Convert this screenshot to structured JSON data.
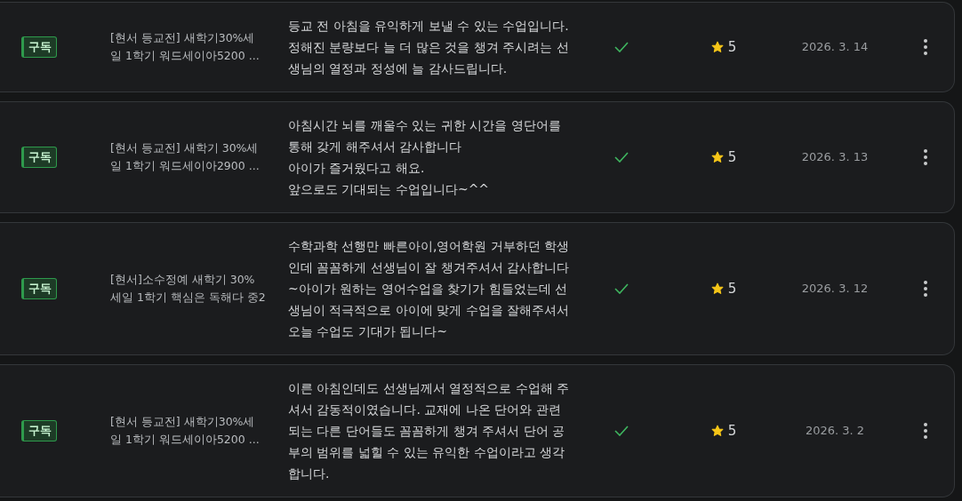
{
  "reviews": [
    {
      "badge": "구독",
      "title_lines": [
        "[현서 등교전] 새학기30%세",
        "일 1학기 워드세이아5200 ..."
      ],
      "review_lines": [
        "등교 전 아침을 유익하게 보낼 수 있는 수업입니다.",
        "정해진 분량보다 늘 더 많은 것을 챙겨 주시려는 선",
        "생님의 열정과 정성에 늘 감사드립니다."
      ],
      "checked": true,
      "rating": "5",
      "date": "2026. 3. 14"
    },
    {
      "badge": "구독",
      "title_lines": [
        "[현서 등교전] 새학기 30%세",
        "일 1학기 워드세이아2900 ..."
      ],
      "review_lines": [
        "아침시간 뇌를 깨울수 있는 귀한 시간을 영단어를",
        "통해 갖게 해주셔서 감사합니다",
        "아이가 즐거웠다고 해요.",
        "앞으로도 기대되는 수업입니다~^^"
      ],
      "checked": true,
      "rating": "5",
      "date": "2026. 3. 13"
    },
    {
      "badge": "구독",
      "title_lines": [
        "[현서]소수정예 새학기 30%",
        "세일 1학기 핵심은 독해다 중2"
      ],
      "review_lines": [
        "수학과학 선행만 빠른아이,영어학원 거부하던 학생",
        "인데 꼼꼼하게 선생님이 잘 챙겨주셔서 감사합니다",
        "~아이가 원하는 영어수업을 찾기가 힘들었는데 선",
        "생님이 적극적으로 아이에 맞게 수업을 잘해주셔서",
        "오늘 수업도 기대가 됩니다~"
      ],
      "checked": true,
      "rating": "5",
      "date": "2026. 3. 12"
    },
    {
      "badge": "구독",
      "title_lines": [
        "[현서 등교전] 새학기30%세",
        "일 1학기 워드세이아5200 ..."
      ],
      "review_lines": [
        "이른 아침인데도 선생님께서 열정적으로 수업해 주",
        "셔서 감동적이였습니다. 교재에 나온 단어와 관련",
        "되는 다른 단어들도 꼼꼼하게 챙겨 주셔서 단어 공",
        "부의 범위를 넓힐 수 있는 유익한 수업이라고 생각",
        "합니다."
      ],
      "checked": true,
      "rating": "5",
      "date": "2026. 3. 2"
    }
  ]
}
